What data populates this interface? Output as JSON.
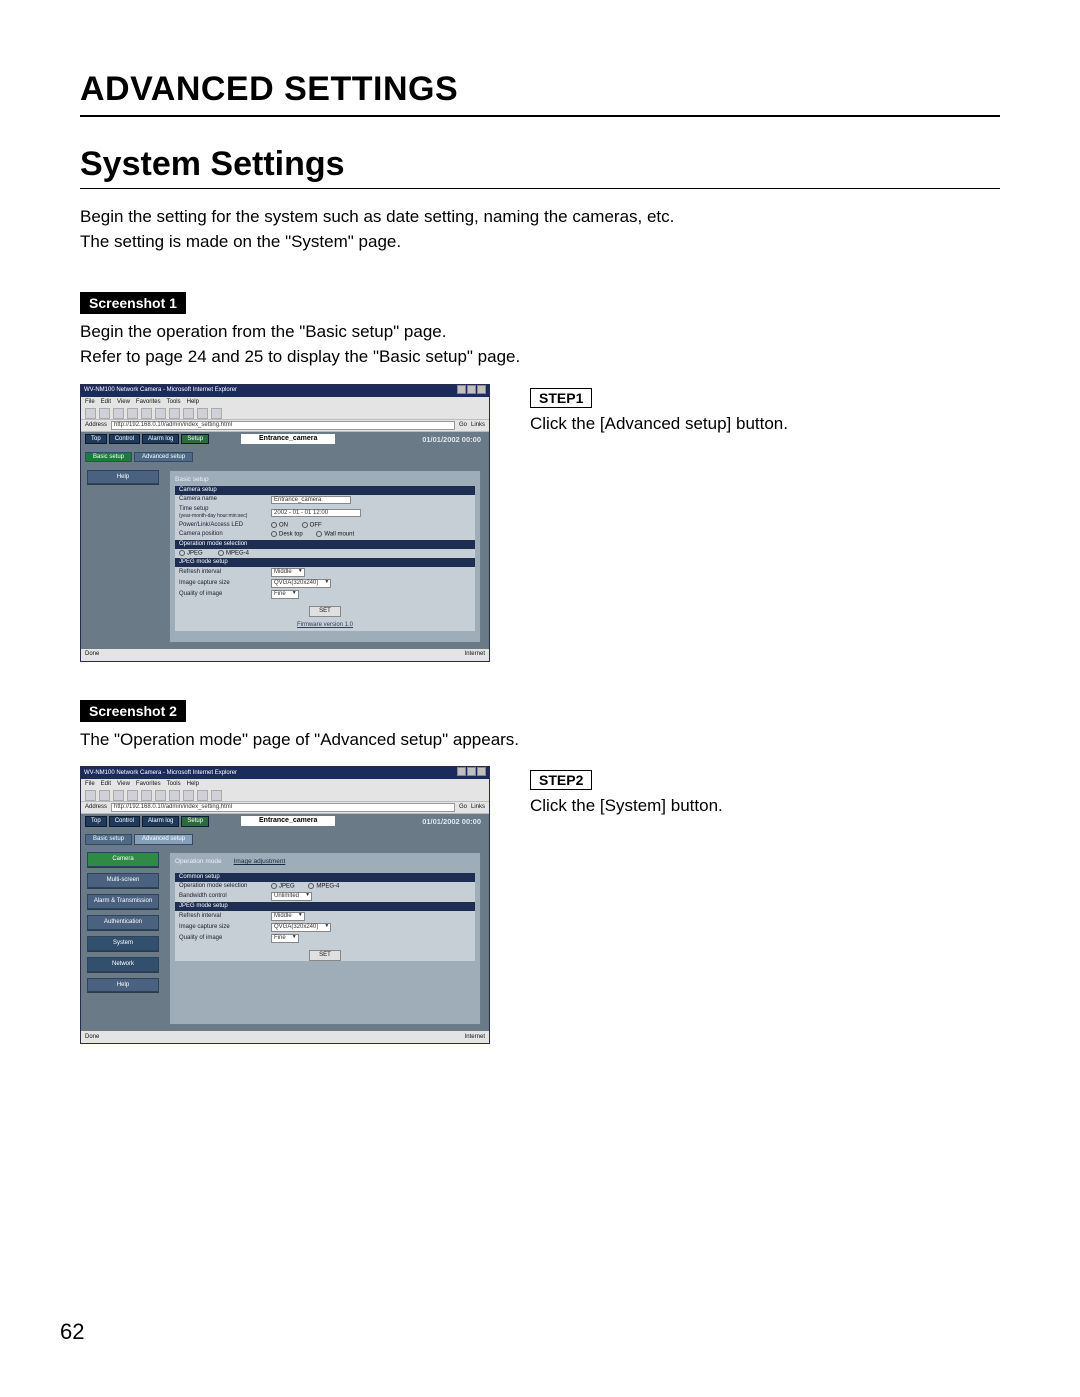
{
  "heading": "ADVANCED SETTINGS",
  "subheading": "System Settings",
  "intro_line1": "Begin the setting for the system such as date setting, naming the cameras, etc.",
  "intro_line2": "The setting is made on the \"System\" page.",
  "page_number": "62",
  "sec1": {
    "badge": "Screenshot 1",
    "line1": "Begin the operation from the \"Basic setup\" page.",
    "line2": "Refer to page 24 and 25 to display the \"Basic setup\" page.",
    "step_label": "STEP1",
    "step_text": "Click the [Advanced setup] button."
  },
  "sec2": {
    "badge": "Screenshot 2",
    "line1": "The \"Operation mode\" page of \"Advanced setup\" appears.",
    "step_label": "STEP2",
    "step_text": "Click the [System] button."
  },
  "browser": {
    "title": "WV-NM100 Network Camera - Microsoft Internet Explorer",
    "menus": [
      "File",
      "Edit",
      "View",
      "Favorites",
      "Tools",
      "Help"
    ],
    "address_label": "Address",
    "url": "http://192.168.0.10/admin/index_setting.html",
    "go": "Go",
    "links": "Links",
    "status_left": "Done",
    "status_right": "Internet"
  },
  "shot_common": {
    "tabs": [
      "Top",
      "Control",
      "Alarm log"
    ],
    "tab_setup": "Setup",
    "camera_name_display": "Entrance_camera",
    "datetime": "01/01/2002  00:00",
    "subtab_basic": "Basic setup",
    "subtab_advanced": "Advanced setup",
    "help": "Help",
    "set": "SET"
  },
  "shot1": {
    "content_title": "Basic setup",
    "bar1": "Camera setup",
    "camera_name_label": "Camera name",
    "camera_name_value": "Entrance_camera",
    "time_setup_label": "Time setup",
    "time_setup_sub": "(year-month-day hour:min:sec)",
    "time_value": "2002 - 01 - 01  12:00",
    "led_label": "Power/Link/Access LED",
    "led_on": "ON",
    "led_off": "OFF",
    "pos_label": "Camera position",
    "pos_desk": "Desk top",
    "pos_wall": "Wall mount",
    "bar2": "Operation mode selection",
    "mode_jpeg": "JPEG",
    "mode_mpeg4": "MPEG-4",
    "bar3": "JPEG mode setup",
    "refresh_label": "Refresh interval",
    "refresh_value": "Middle",
    "size_label": "Image capture size",
    "size_value": "QVGA(320x240)",
    "quality_label": "Quality of image",
    "quality_value": "Fine",
    "firmware": "Firmware version  1.0"
  },
  "shot2": {
    "content_title": "Operation mode",
    "tab2": "Image adjustment",
    "side": {
      "camera": "Camera",
      "multi": "Multi-screen",
      "alarm": "Alarm & Transmission",
      "auth": "Authentication",
      "system": "System",
      "network": "Network",
      "help": "Help"
    },
    "bar1": "Common setup",
    "op_label": "Operation mode selection",
    "bw_label": "Bandwidth control",
    "bw_value": "Unlimited",
    "bar2": "JPEG mode setup",
    "refresh_label": "Refresh interval",
    "refresh_value": "Middle",
    "size_label": "Image capture size",
    "size_value": "QVGA(320x240)",
    "quality_label": "Quality of image",
    "quality_value": "Fine"
  }
}
